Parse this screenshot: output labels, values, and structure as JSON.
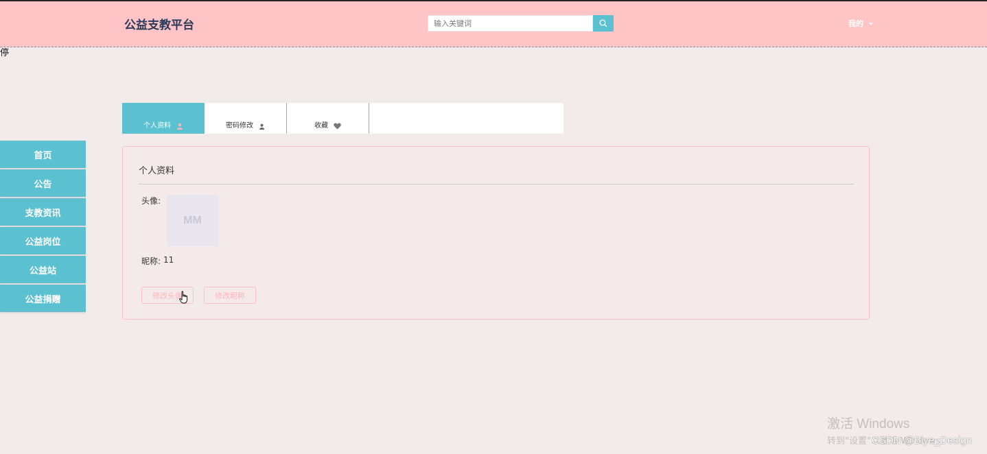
{
  "header": {
    "brand": "公益支教平台",
    "search_placeholder": "输入关键词",
    "search_icon": "search-icon",
    "user_menu_label": "我的"
  },
  "stray_char": "停",
  "tabs": [
    {
      "label": "个人资料",
      "icon": "user-circle-icon",
      "active": true
    },
    {
      "label": "密码修改",
      "icon": "person-icon",
      "active": false
    },
    {
      "label": "收藏",
      "icon": "heart-icon",
      "active": false
    }
  ],
  "sidebar": {
    "items": [
      {
        "label": "首页"
      },
      {
        "label": "公告"
      },
      {
        "label": "支教资讯"
      },
      {
        "label": "公益岗位"
      },
      {
        "label": "公益站"
      },
      {
        "label": "公益捐赠"
      }
    ]
  },
  "profile": {
    "title": "个人资料",
    "avatar_label": "头像:",
    "avatar_text": "MM",
    "nickname_label": "昵称:",
    "nickname_value": "11",
    "change_avatar_button": "修改头像",
    "change_nickname_button": "修改昵称"
  },
  "watermark": {
    "windows_title": "激活 Windows",
    "windows_sub": "转到\"设置\"以激活 Windows。",
    "csdn": "CSDN @Biye_Design"
  },
  "colors": {
    "header_bg": "#ffc4c6",
    "accent": "#5bc0d0",
    "page_bg": "#f3eaea",
    "button_pink": "#ffb3bd"
  }
}
